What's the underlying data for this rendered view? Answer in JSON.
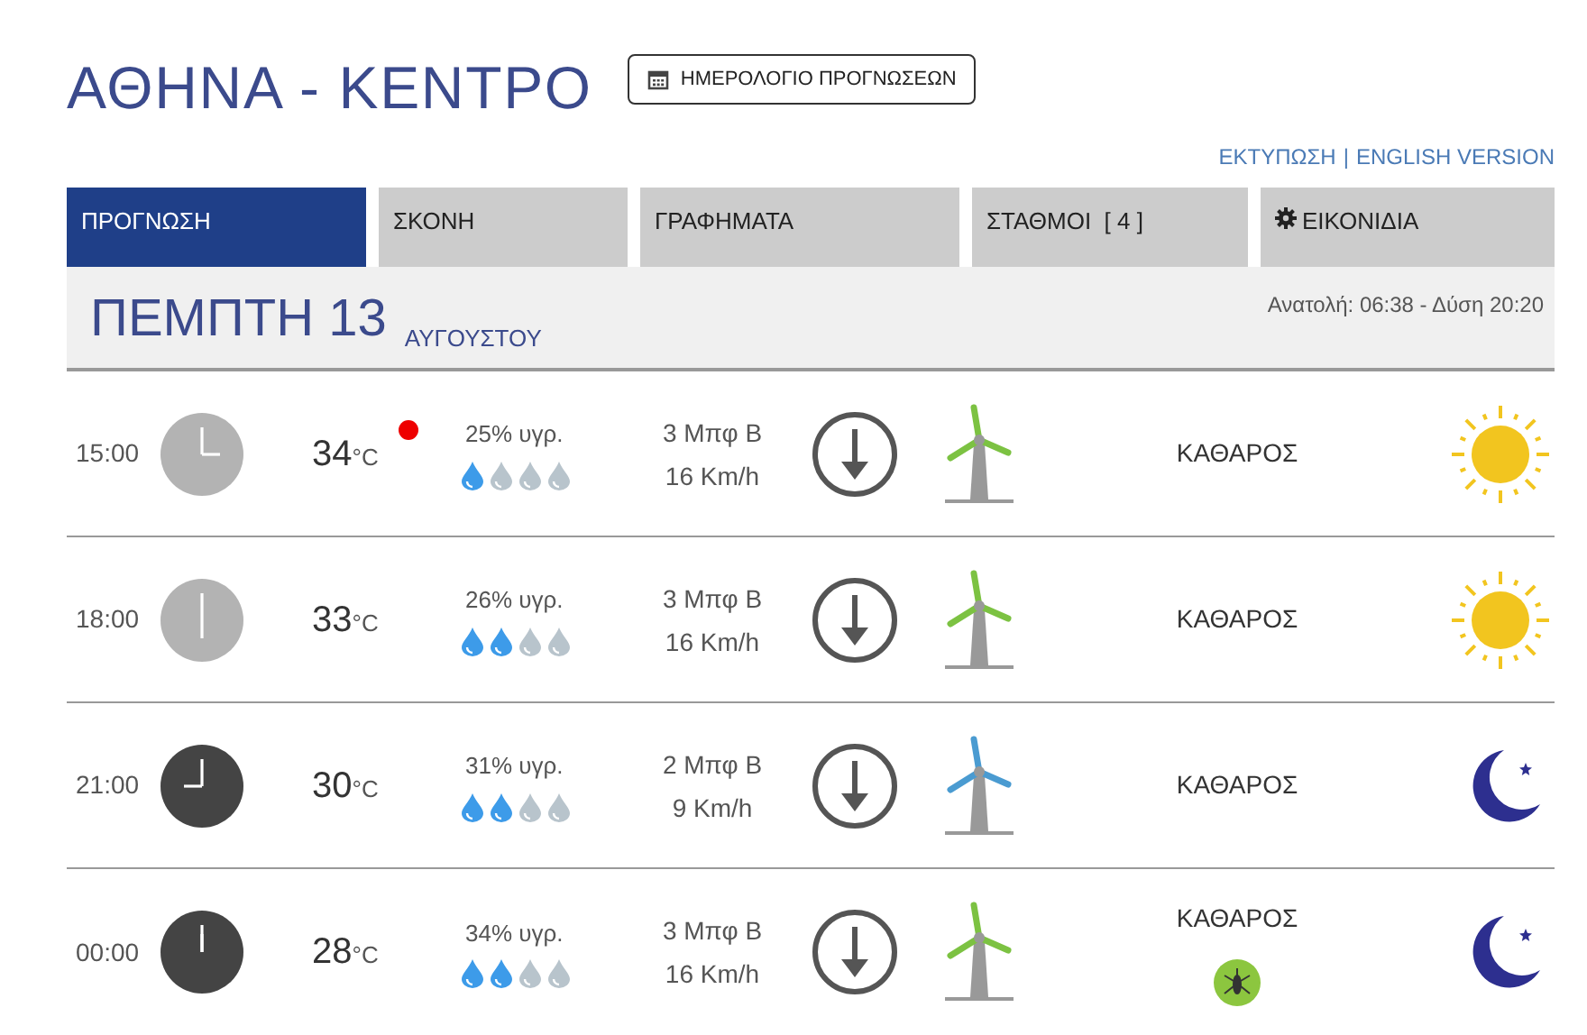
{
  "title": "ΑΘΗΝΑ - ΚΕΝΤΡΟ",
  "calendar_button": "ΗΜΕΡΟΛΟΓΙΟ ΠΡΟΓΝΩΣΕΩΝ",
  "links": [
    "ΕΚΤΥΠΩΣΗ",
    "|",
    "ENGLISH VERSION"
  ],
  "tabs": [
    {
      "label": "ΠΡΟΓΝΩΣΗ",
      "selected": true,
      "kind": "text"
    },
    {
      "label": "ΣΚΟΝΗ",
      "selected": false,
      "kind": "text"
    },
    {
      "label": "ΓΡΑΦΗΜΑΤΑ",
      "selected": false,
      "kind": "text"
    },
    {
      "label": "ΣΤΑΘΜΟΙ  [ 4 ]",
      "selected": false,
      "kind": "text"
    },
    {
      "label": "ΕΙΚΟΝΙΔΙΑ",
      "selected": false,
      "kind": "gear"
    }
  ],
  "day": {
    "weekday": "ΠΕΜΠΤΗ 13",
    "month": "ΑΥΓΟΥΣΤΟΥ",
    "sun": "Ανατολή: 06:38  - Δύση 20:20"
  },
  "rows": [
    {
      "time": "15:00",
      "kind": "day",
      "temp": "34",
      "unit": "°C",
      "alert": true,
      "humidity": "25% υγρ.",
      "stars": 1,
      "beaufort": "3 Μπφ Β",
      "speed": "16 Km/h",
      "color": "#7cc242",
      "condition": "ΚΑΘΑΡΟΣ",
      "mosquito": false
    },
    {
      "time": "18:00",
      "kind": "day",
      "temp": "33",
      "unit": "°C",
      "alert": false,
      "humidity": "26% υγρ.",
      "stars": 2,
      "beaufort": "3 Μπφ Β",
      "speed": "16 Km/h",
      "color": "#7cc242",
      "condition": "ΚΑΘΑΡΟΣ",
      "mosquito": false
    },
    {
      "time": "21:00",
      "kind": "night",
      "temp": "30",
      "unit": "°C",
      "alert": false,
      "humidity": "31% υγρ.",
      "stars": 2,
      "beaufort": "2 Μπφ Β",
      "speed": "9 Km/h",
      "color": "#4a9bd1",
      "condition": "ΚΑΘΑΡΟΣ",
      "mosquito": false
    },
    {
      "time": "00:00",
      "kind": "night",
      "temp": "28",
      "unit": "°C",
      "alert": false,
      "humidity": "34% υγρ.",
      "stars": 2,
      "beaufort": "3 Μπφ Β",
      "speed": "16 Km/h",
      "color": "#7cc242",
      "condition": "ΚΑΘΑΡΟΣ",
      "mosquito": true
    }
  ]
}
